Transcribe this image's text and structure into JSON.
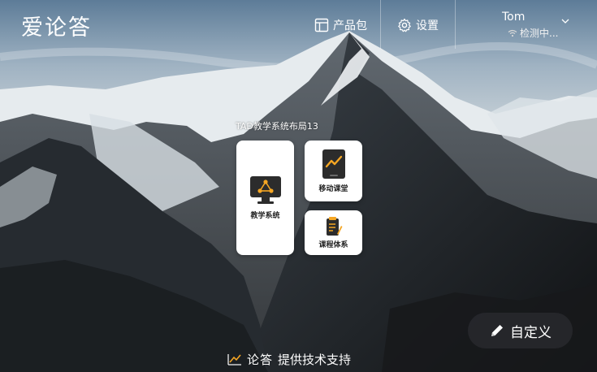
{
  "header": {
    "logo_text": "爱论答",
    "product_pack_label": "产品包",
    "settings_label": "设置",
    "user_name": "Tom",
    "user_status": "检测中..."
  },
  "main": {
    "layout_title": "TAD教学系统布局13",
    "cards": [
      {
        "label": "教学系统",
        "icon": "monitor-network-icon"
      },
      {
        "label": "移动课堂",
        "icon": "tablet-chart-icon"
      },
      {
        "label": "课程体系",
        "icon": "document-pen-icon"
      }
    ],
    "custom_button_label": "自定义"
  },
  "footer": {
    "brand_text": "论答",
    "support_text": "提供技术支持"
  },
  "colors": {
    "accent": "#f5a623",
    "card_bg": "#ffffff",
    "button_bg": "#2b2d31"
  }
}
